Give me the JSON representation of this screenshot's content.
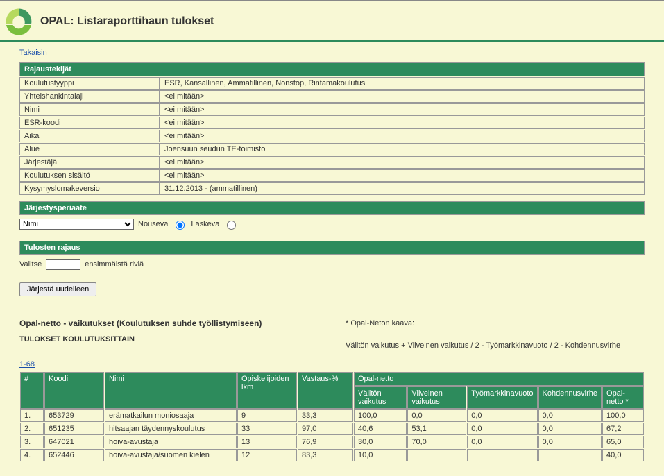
{
  "header": {
    "title": "OPAL: Listaraporttihaun tulokset"
  },
  "nav": {
    "back": "Takaisin"
  },
  "criteria": {
    "section_title": "Rajaustekijät",
    "rows": [
      {
        "label": "Koulutustyyppi",
        "value": "ESR, Kansallinen, Ammatillinen, Nonstop, Rintamakoulutus"
      },
      {
        "label": "Yhteishankintalaji",
        "value": "<ei mitään>"
      },
      {
        "label": "Nimi",
        "value": "<ei mitään>"
      },
      {
        "label": "ESR-koodi",
        "value": "<ei mitään>"
      },
      {
        "label": "Aika",
        "value": "<ei mitään>"
      },
      {
        "label": "Alue",
        "value": "Joensuun seudun TE-toimisto"
      },
      {
        "label": "Järjestäjä",
        "value": "<ei mitään>"
      },
      {
        "label": "Koulutuksen sisältö",
        "value": "<ei mitään>"
      },
      {
        "label": "Kysymyslomakeversio",
        "value": "31.12.2013 - (ammatillinen)"
      }
    ]
  },
  "sort": {
    "section_title": "Järjestysperiaate",
    "field_value": "Nimi",
    "asc_label": "Nouseva",
    "desc_label": "Laskeva"
  },
  "limit": {
    "section_title": "Tulosten rajaus",
    "prefix": "Valitse",
    "value": "",
    "suffix": "ensimmäistä riviä"
  },
  "buttons": {
    "reorder": "Järjestä uudelleen"
  },
  "info": {
    "left_title": "Opal-netto - vaikutukset (Koulutuksen suhde työllistymiseen)",
    "left_subtitle": "TULOKSET KOULUTUKSITTAIN",
    "right_title": "* Opal-Neton kaava:",
    "right_body": "Välitön vaikutus + Viiveinen vaikutus / 2 - Työmarkkinavuoto / 2 - Kohdennusvirhe"
  },
  "range_link": "1-68",
  "table": {
    "headers": {
      "rownum": "#",
      "koodi": "Koodi",
      "nimi": "Nimi",
      "lkm": "Opiskelijoiden lkm",
      "vastaus": "Vastaus-%",
      "opalnetto": "Opal-netto",
      "valiton": "Välitön vaikutus",
      "viiveinen": "Viiveinen vaikutus",
      "tyomark": "Työmarkkinavuoto",
      "kohd": "Kohdennusvirhe",
      "netto": "Opal-netto *"
    },
    "rows": [
      {
        "n": "1.",
        "koodi": "653729",
        "nimi": "erämatkailun moniosaaja",
        "lkm": "9",
        "vastaus": "33,3",
        "valiton": "100,0",
        "viiveinen": "0,0",
        "tyomark": "0,0",
        "kohd": "0,0",
        "netto": "100,0"
      },
      {
        "n": "2.",
        "koodi": "651235",
        "nimi": "hitsaajan täydennyskoulutus",
        "lkm": "33",
        "vastaus": "97,0",
        "valiton": "40,6",
        "viiveinen": "53,1",
        "tyomark": "0,0",
        "kohd": "0,0",
        "netto": "67,2"
      },
      {
        "n": "3.",
        "koodi": "647021",
        "nimi": "hoiva-avustaja",
        "lkm": "13",
        "vastaus": "76,9",
        "valiton": "30,0",
        "viiveinen": "70,0",
        "tyomark": "0,0",
        "kohd": "0,0",
        "netto": "65,0"
      },
      {
        "n": "4.",
        "koodi": "652446",
        "nimi": "hoiva-avustaja/suomen kielen",
        "lkm": "12",
        "vastaus": "83,3",
        "valiton": "10,0",
        "viiveinen": "",
        "tyomark": "",
        "kohd": "",
        "netto": "40,0"
      }
    ]
  },
  "chart_data": {
    "type": "table",
    "title": "Opal-netto - vaikutukset (Koulutuksen suhde työllistymiseen)",
    "columns": [
      "#",
      "Koodi",
      "Nimi",
      "Opiskelijoiden lkm",
      "Vastaus-%",
      "Välitön vaikutus",
      "Viiveinen vaikutus",
      "Työmarkkinavuoto",
      "Kohdennusvirhe",
      "Opal-netto *"
    ],
    "rows": [
      [
        "1.",
        "653729",
        "erämatkailun moniosaaja",
        9,
        33.3,
        100.0,
        0.0,
        0.0,
        0.0,
        100.0
      ],
      [
        "2.",
        "651235",
        "hitsaajan täydennyskoulutus",
        33,
        97.0,
        40.6,
        53.1,
        0.0,
        0.0,
        67.2
      ],
      [
        "3.",
        "647021",
        "hoiva-avustaja",
        13,
        76.9,
        30.0,
        70.0,
        0.0,
        0.0,
        65.0
      ],
      [
        "4.",
        "652446",
        "hoiva-avustaja/suomen kielen",
        12,
        83.3,
        10.0,
        null,
        null,
        null,
        40.0
      ]
    ]
  }
}
